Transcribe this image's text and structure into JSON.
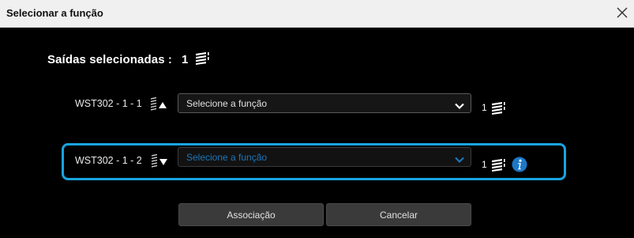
{
  "window": {
    "title": "Selecionar a função"
  },
  "summary": {
    "label": "Saídas selecionadas :",
    "count": "1",
    "icon": "stack-icon"
  },
  "outputs": [
    {
      "name": "WST302 - 1 - 1",
      "sort_icon": "sort-ascending-icon",
      "select_value": "Selecione a função",
      "count": "1",
      "count_icon": "stack-icon"
    },
    {
      "name": "WST302 - 1 - 2",
      "sort_icon": "sort-descending-icon",
      "select_value": "Selecione a função",
      "count": "1",
      "count_icon": "stack-icon",
      "info_icon": "info-icon",
      "highlighted": true
    }
  ],
  "buttons": {
    "associate": "Associação",
    "cancel": "Cancelar"
  },
  "colors": {
    "background": "#000000",
    "titlebar": "#f0f0f0",
    "highlight": "#19a4e0",
    "info": "#1c78c8",
    "button": "#3a3a3a"
  }
}
